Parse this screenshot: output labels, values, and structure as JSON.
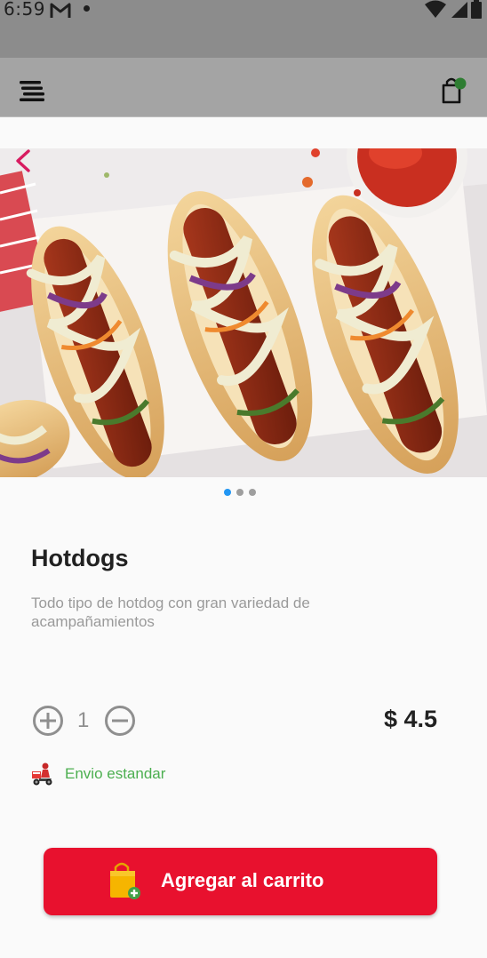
{
  "status_bar": {
    "time": "6:59",
    "icons": [
      "gmail-icon",
      "dot-icon",
      "wifi-icon",
      "signal-icon",
      "battery-icon"
    ]
  },
  "app_bar": {
    "menu_icon": "menu-icon",
    "cart_icon": "shopping-bag-icon",
    "cart_badge_color": "#2e7d32"
  },
  "product": {
    "image_alt": "hotdog-photo",
    "image_pages": 3,
    "active_page": 1,
    "title": "Hotdogs",
    "description": "Todo tipo de hotdog con gran variedad de acampañamientos",
    "quantity": "1",
    "price": "$ 4.5"
  },
  "shipping": {
    "label": "Envio estandar",
    "color": "#4caf50"
  },
  "cta": {
    "label": "Agregar al carrito",
    "color": "#e8112e"
  }
}
